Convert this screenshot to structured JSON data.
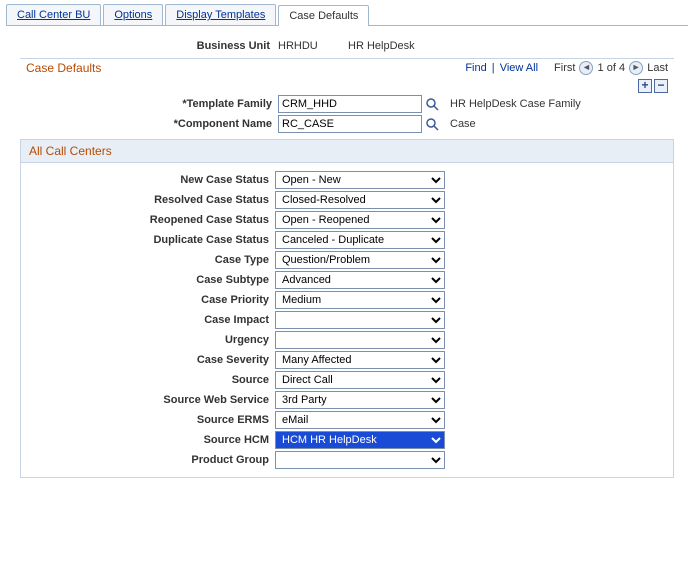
{
  "tabs": {
    "t0": "Call Center BU",
    "t1": "Options",
    "t2": "Display Templates",
    "t3": "Case Defaults"
  },
  "bu": {
    "label": "Business Unit",
    "code": "HRHDU",
    "name": "HR HelpDesk"
  },
  "section": {
    "title": "Case Defaults",
    "find": "Find",
    "viewall": "View All",
    "first": "First",
    "counter": "1 of 4",
    "last": "Last"
  },
  "tf": {
    "label": "*Template Family",
    "value": "CRM_HHD",
    "desc": "HR HelpDesk Case Family"
  },
  "cn": {
    "label": "*Component Name",
    "value": "RC_CASE",
    "desc": "Case"
  },
  "sub": {
    "title": "All Call Centers"
  },
  "fields": {
    "newStatus": {
      "label": "New Case Status",
      "value": "Open - New"
    },
    "resolved": {
      "label": "Resolved Case Status",
      "value": "Closed-Resolved"
    },
    "reopened": {
      "label": "Reopened Case Status",
      "value": "Open - Reopened"
    },
    "duplicate": {
      "label": "Duplicate Case Status",
      "value": "Canceled - Duplicate"
    },
    "caseType": {
      "label": "Case Type",
      "value": "Question/Problem"
    },
    "subtype": {
      "label": "Case Subtype",
      "value": "Advanced"
    },
    "priority": {
      "label": "Case Priority",
      "value": "Medium"
    },
    "impact": {
      "label": "Case Impact",
      "value": ""
    },
    "urgency": {
      "label": "Urgency",
      "value": ""
    },
    "severity": {
      "label": "Case Severity",
      "value": "Many Affected"
    },
    "source": {
      "label": "Source",
      "value": "Direct Call"
    },
    "srcWeb": {
      "label": "Source Web Service",
      "value": "3rd Party"
    },
    "srcErms": {
      "label": "Source ERMS",
      "value": "eMail"
    },
    "srcHcm": {
      "label": "Source HCM",
      "value": "HCM HR HelpDesk"
    },
    "prodGrp": {
      "label": "Product Group",
      "value": ""
    }
  }
}
